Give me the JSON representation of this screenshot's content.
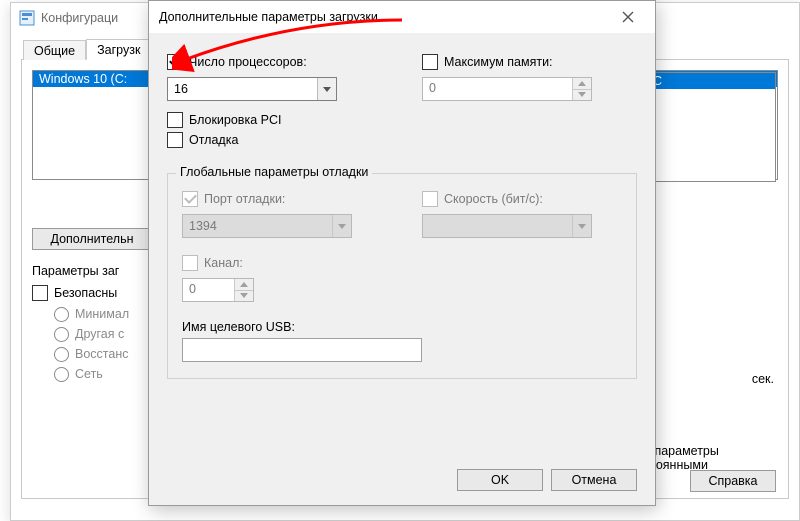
{
  "parent": {
    "title": "Конфигураци",
    "tabs": {
      "general": "Общие",
      "boot": "Загрузк"
    },
    "boot_entry": "Windows 10 (C:",
    "right_entry": "C",
    "advanced_button": "Дополнительн",
    "boot_params_label": "Параметры заг",
    "chk_safe": "Безопасны",
    "radio_min": "Минимал",
    "radio_other": "Другая с",
    "radio_restore": "Восстанс",
    "radio_net": "Сеть",
    "timeout_suffix": "сек.",
    "perm1": "и параметры",
    "perm2": "стоянными",
    "help_button": "Справка"
  },
  "modal": {
    "title": "Дополнительные параметры загрузки",
    "chk_num_processors": "Число процессоров:",
    "num_processors_value": "16",
    "chk_max_memory": "Максимум памяти:",
    "max_memory_value": "0",
    "chk_pci_lock": "Блокировка PCI",
    "chk_debug": "Отладка",
    "group_title": "Глобальные параметры отладки",
    "chk_debug_port": "Порт отладки:",
    "debug_port_value": "1394",
    "chk_speed": "Скорость (бит/с):",
    "chk_channel": "Канал:",
    "channel_value": "0",
    "usb_label": "Имя целевого USB:",
    "btn_ok": "OK",
    "btn_cancel": "Отмена"
  }
}
